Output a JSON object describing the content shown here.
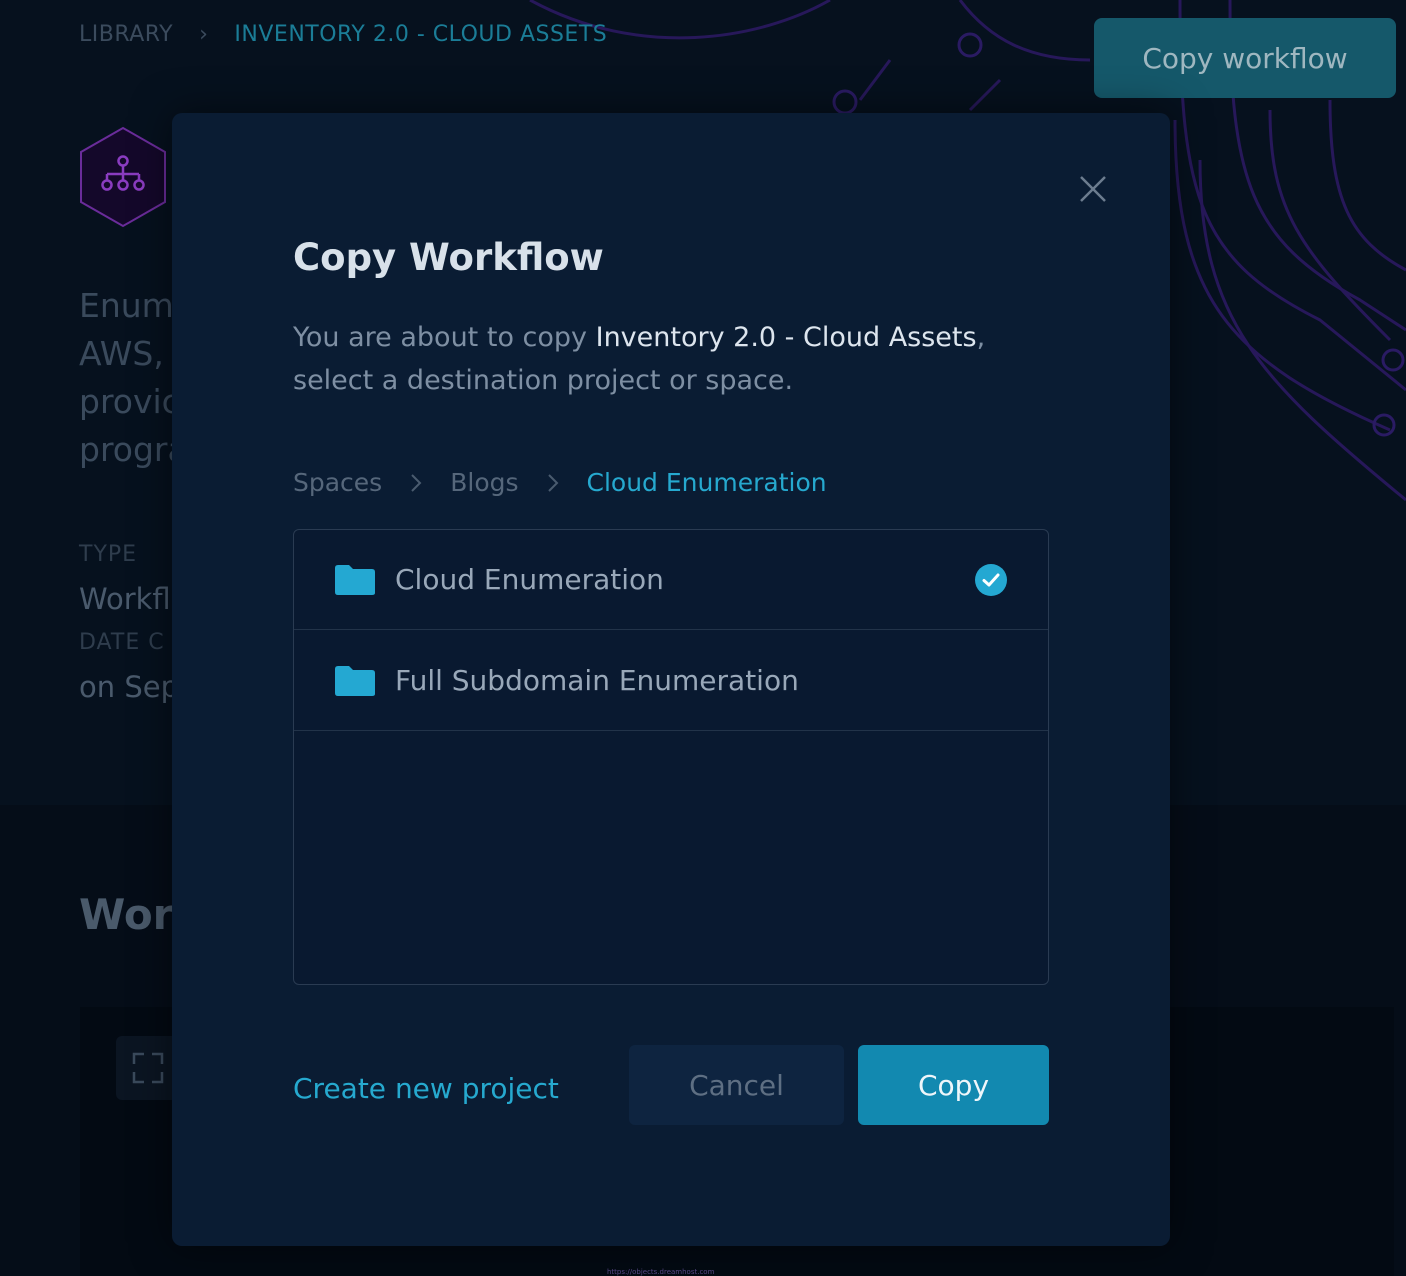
{
  "breadcrumb": {
    "items": [
      "LIBRARY",
      "INVENTORY 2.0 - CLOUD ASSETS"
    ]
  },
  "header": {
    "copy_workflow_label": "Copy workflow"
  },
  "background": {
    "description_lines": [
      "Enum",
      "AWS,",
      "provic",
      "progra"
    ],
    "type_label": "TYPE",
    "type_value": "Workfl",
    "date_label": "DATE C",
    "date_value": "on Sep",
    "section_title": "Work",
    "canvas_url": "https://objects.dreamhost.com"
  },
  "modal": {
    "title": "Copy Workflow",
    "text_prefix": "You are about to copy ",
    "workflow_name": "Inventory 2.0 - Cloud Assets",
    "text_suffix": ",",
    "text_line2": "select a destination project or space.",
    "crumbs": [
      "Spaces",
      "Blogs",
      "Cloud Enumeration"
    ],
    "items": [
      {
        "label": "Cloud Enumeration",
        "selected": true
      },
      {
        "label": "Full Subdomain Enumeration",
        "selected": false
      }
    ],
    "create_link": "Create new project",
    "cancel_label": "Cancel",
    "copy_label": "Copy"
  },
  "colors": {
    "accent": "#26a9cf",
    "primary_button": "#1289b0",
    "modal_bg": "#0a1c33",
    "circuit": "#2b1a5e"
  },
  "icons": [
    "hierarchy-icon",
    "close-icon",
    "chevron-right-icon",
    "folder-icon",
    "check-circle-icon",
    "fullscreen-icon"
  ]
}
